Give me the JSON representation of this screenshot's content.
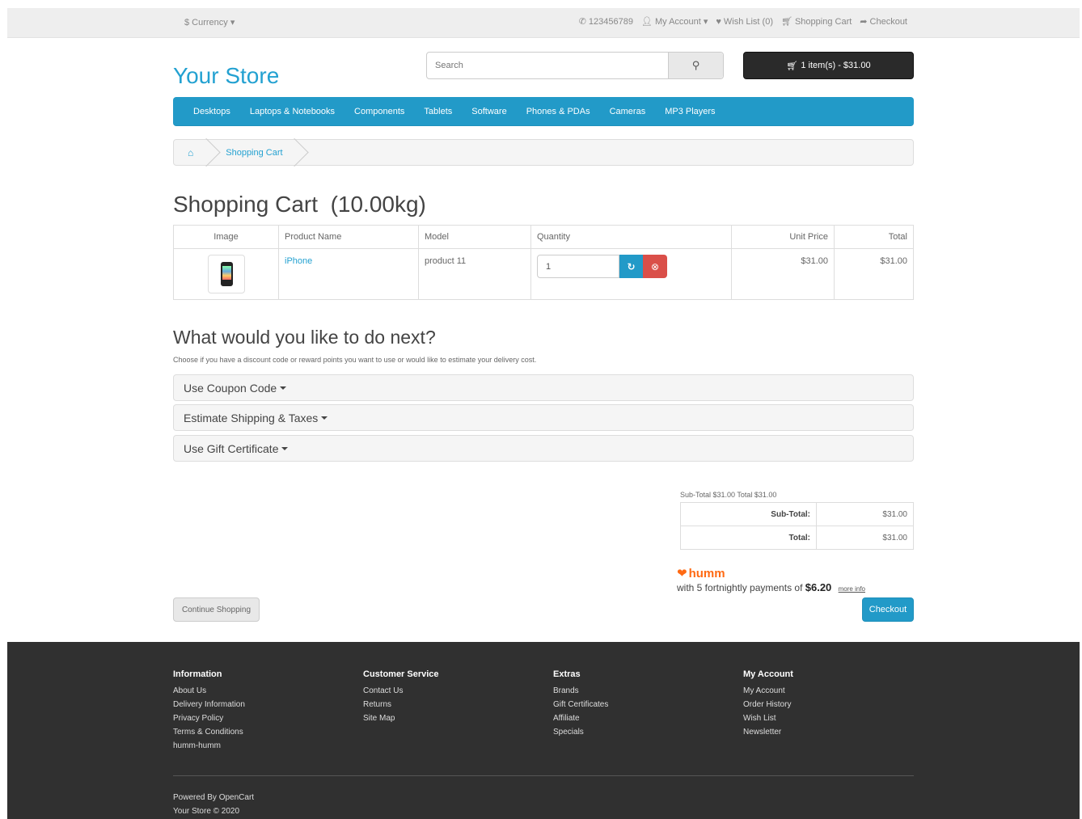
{
  "topbar": {
    "currency_label": "$ Currency",
    "phone": "123456789",
    "my_account": "My Account",
    "wishlist": "Wish List (0)",
    "shopping_cart": "Shopping Cart",
    "checkout": "Checkout"
  },
  "header": {
    "logo": "Your Store",
    "search_placeholder": "Search",
    "cart_summary": "1 item(s) - $31.00"
  },
  "menu": [
    "Desktops",
    "Laptops & Notebooks",
    "Components",
    "Tablets",
    "Software",
    "Phones & PDAs",
    "Cameras",
    "MP3 Players"
  ],
  "breadcrumb": {
    "current": "Shopping Cart"
  },
  "page_title": "Shopping Cart  (10.00kg)",
  "cart": {
    "headers": {
      "image": "Image",
      "name": "Product Name",
      "model": "Model",
      "quantity": "Quantity",
      "unit_price": "Unit Price",
      "total": "Total"
    },
    "rows": [
      {
        "name": "iPhone",
        "model": "product 11",
        "quantity": "1",
        "unit_price": "$31.00",
        "total": "$31.00"
      }
    ]
  },
  "next": {
    "title": "What would you like to do next?",
    "description": "Choose if you have a discount code or reward points you want to use or would like to estimate your delivery cost.",
    "panels": [
      "Use Coupon Code",
      "Estimate Shipping & Taxes",
      "Use Gift Certificate"
    ]
  },
  "totals": {
    "caption": "Sub-Total $31.00 Total $31.00",
    "subtotal_label": "Sub-Total:",
    "subtotal_value": "$31.00",
    "total_label": "Total:",
    "total_value": "$31.00"
  },
  "humm": {
    "logo": "humm",
    "text_prefix": "with 5 fortnightly payments of ",
    "amount": "$6.20",
    "more_info": "more info",
    "brand_color": "#ff6a13"
  },
  "buttons": {
    "continue": "Continue Shopping",
    "checkout": "Checkout"
  },
  "footer": {
    "columns": [
      {
        "title": "Information",
        "links": [
          "About Us",
          "Delivery Information",
          "Privacy Policy",
          "Terms & Conditions",
          "humm-humm"
        ]
      },
      {
        "title": "Customer Service",
        "links": [
          "Contact Us",
          "Returns",
          "Site Map"
        ]
      },
      {
        "title": "Extras",
        "links": [
          "Brands",
          "Gift Certificates",
          "Affiliate",
          "Specials"
        ]
      },
      {
        "title": "My Account",
        "links": [
          "My Account",
          "Order History",
          "Wish List",
          "Newsletter"
        ]
      }
    ],
    "powered_prefix": "Powered By ",
    "powered_link": "OpenCart",
    "copyright": "Your Store © 2020"
  },
  "colors": {
    "accent": "#229ac8",
    "danger": "#da4f49",
    "footer_bg": "#303030"
  }
}
